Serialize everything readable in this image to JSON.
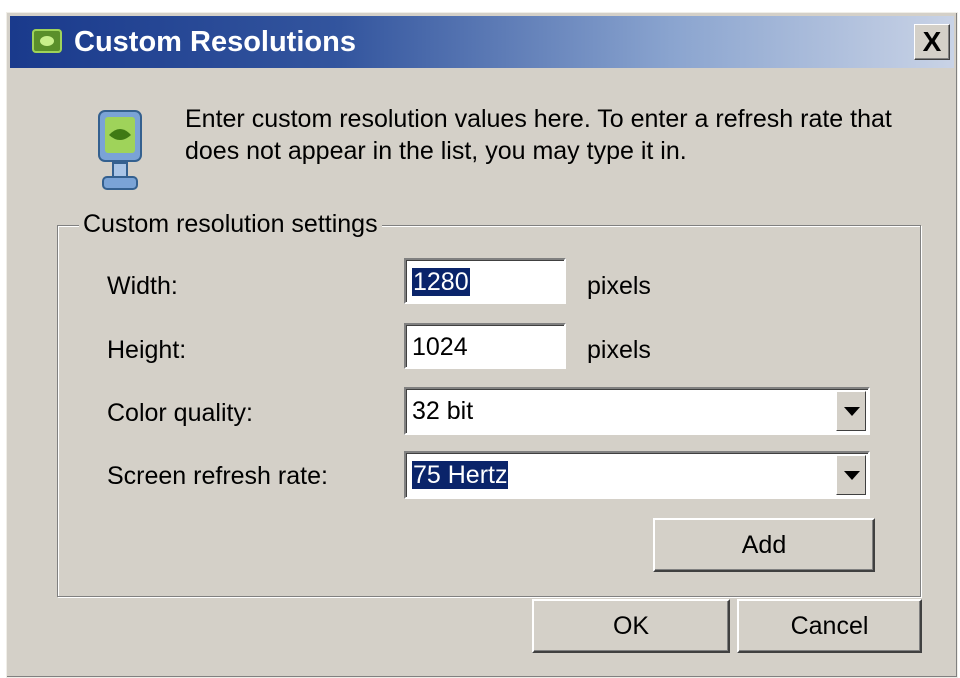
{
  "window": {
    "title": "Custom Resolutions",
    "close_glyph": "X"
  },
  "description": "Enter custom resolution values here. To enter a refresh rate that does not appear in the list, you may type it in.",
  "group": {
    "label": "Custom resolution settings"
  },
  "fields": {
    "width": {
      "label": "Width:",
      "value": "1280",
      "unit": "pixels"
    },
    "height": {
      "label": "Height:",
      "value": "1024",
      "unit": "pixels"
    },
    "color_quality": {
      "label": "Color quality:",
      "selected": "32 bit"
    },
    "refresh_rate": {
      "label": "Screen refresh rate:",
      "selected": "75 Hertz"
    }
  },
  "buttons": {
    "add": "Add",
    "ok": "OK",
    "cancel": "Cancel"
  },
  "icons": {
    "app": "nvidia-logo-icon",
    "monitor": "monitor-icon",
    "close": "close-icon",
    "dropdown": "chevron-down-icon"
  },
  "colors": {
    "dialog_bg": "#d4d0c8",
    "titlebar_start": "#1a3a8c",
    "titlebar_end": "#c9d3e6",
    "selection": "#0a246a"
  }
}
